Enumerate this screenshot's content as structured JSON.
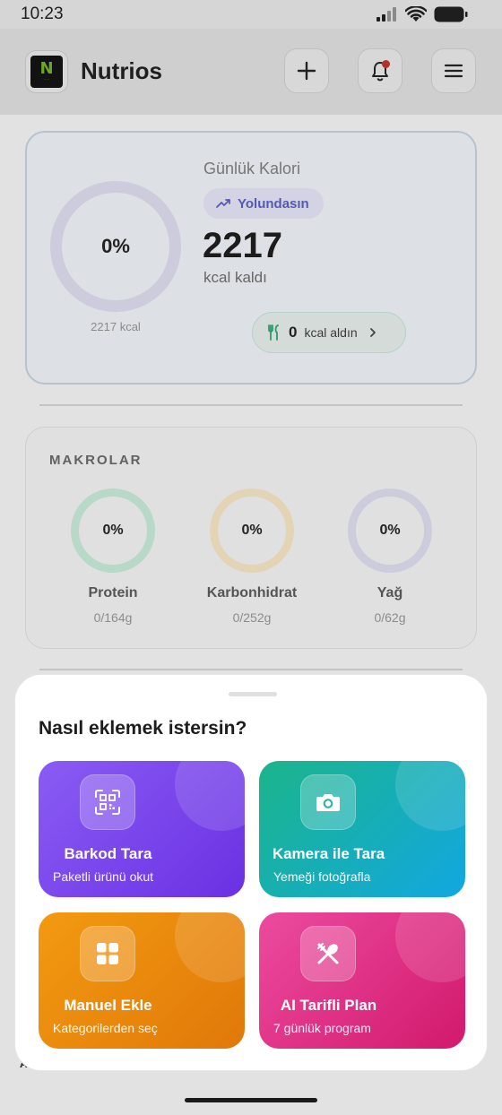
{
  "status_bar": {
    "time": "10:23"
  },
  "header": {
    "app_name": "Nutrios"
  },
  "calorie_card": {
    "title": "Günlük Kalori",
    "status_badge": "Yolundasın",
    "percent_text": "0%",
    "progress": 0,
    "goal_kcal_text": "2217 kcal",
    "remaining": "2217",
    "remaining_label": "kcal kaldı",
    "eaten_value": "0",
    "eaten_label": "kcal aldın"
  },
  "macros": {
    "title": "MAKROLAR",
    "items": [
      {
        "name": "Protein",
        "percent": "0%",
        "value": "0/164g",
        "color": "#b8d8c8"
      },
      {
        "name": "Karbonhidrat",
        "percent": "0%",
        "value": "0/252g",
        "color": "#e4d4b6"
      },
      {
        "name": "Yağ",
        "percent": "0%",
        "value": "0/62g",
        "color": "#ccccdd"
      }
    ]
  },
  "sheet": {
    "title": "Nasıl eklemek istersin?",
    "options": [
      {
        "label": "Barkod Tara",
        "subtitle": "Paketli ürünü okut",
        "icon": "qr-scan-icon",
        "color": "#7c45ee"
      },
      {
        "label": "Kamera ile Tara",
        "subtitle": "Yemeği fotoğrafla",
        "icon": "camera-icon",
        "color": "#16aeb6"
      },
      {
        "label": "Manuel Ekle",
        "subtitle": "Kategorilerden seç",
        "icon": "grid-icon",
        "color": "#ea8a0e"
      },
      {
        "label": "AI Tarifli Plan",
        "subtitle": "7 günlük program",
        "icon": "fork-spoon-icon",
        "color": "#e03586"
      }
    ]
  },
  "background_nav": {
    "left_edge_text": "A"
  },
  "colors": {
    "overlay": "#cfcfcf",
    "accent_purple": "#5559b5",
    "notification_dot": "#b3312b"
  }
}
